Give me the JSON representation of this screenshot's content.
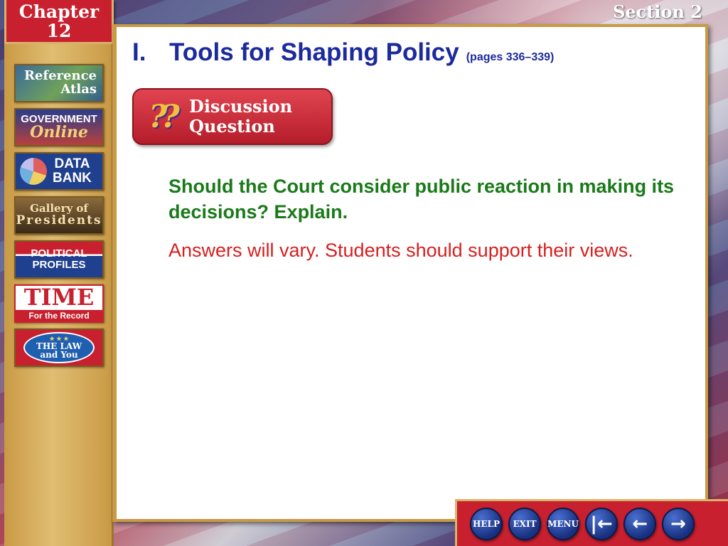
{
  "header": {
    "chapter_word": "Chapter",
    "chapter_number": "12",
    "section": "Section 2"
  },
  "sidebar": {
    "items": [
      {
        "line1": "Reference",
        "line2": "Atlas"
      },
      {
        "line1": "GOVERNMENT",
        "line2": "Online"
      },
      {
        "line1": "DATA",
        "line2": "BANK"
      },
      {
        "line1": "Gallery of",
        "line2": "Presidents"
      },
      {
        "line1": "POLITICAL",
        "line2": "PROFILES"
      },
      {
        "line1": "TIME",
        "line2": "For the Record"
      },
      {
        "line1": "THE LAW",
        "line2": "and You"
      }
    ]
  },
  "main": {
    "heading_number": "I.",
    "heading_title": "Tools for Shaping Policy",
    "heading_pages": "(pages 336–339)",
    "badge_icon": "??",
    "badge_line1": "Discussion",
    "badge_line2": "Question",
    "question": "Should the Court consider public reaction in making its decisions? Explain.",
    "answer": "Answers will vary. Students should support their views."
  },
  "footer": {
    "help_label": "HELP",
    "exit_label": "EXIT",
    "menu_label": "MENU",
    "first_glyph": "|←",
    "prev_glyph": "←",
    "next_glyph": "→"
  },
  "colors": {
    "heading": "#1c2a9c",
    "question": "#1a7a1a",
    "answer": "#d81e1e",
    "accent_red": "#c8202e",
    "gold": "#c99a45"
  }
}
